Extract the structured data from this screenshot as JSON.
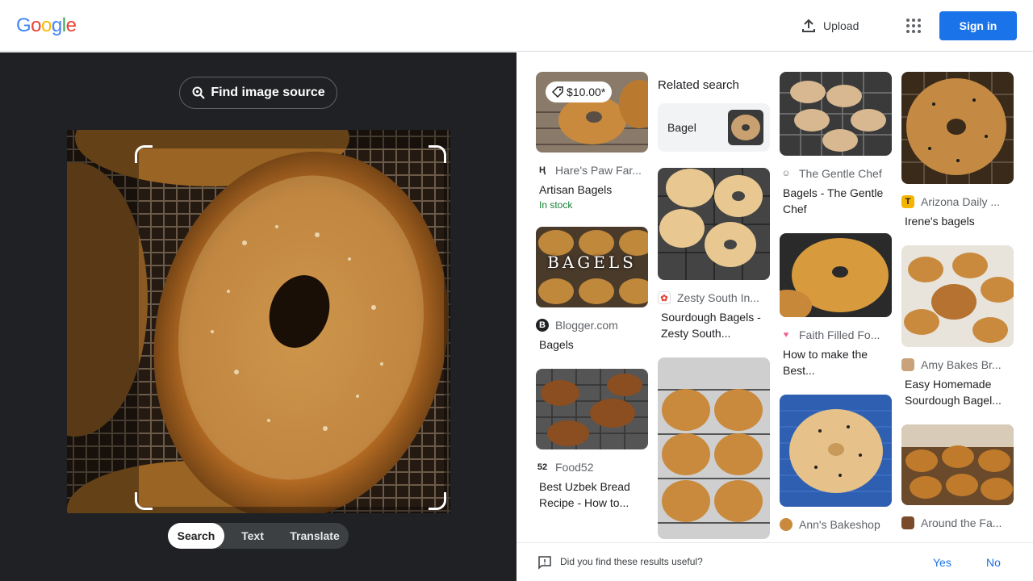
{
  "header": {
    "logo_letters": [
      "G",
      "o",
      "o",
      "g",
      "l",
      "e"
    ],
    "logo_colors": [
      "#4285f4",
      "#ea4335",
      "#fbbc05",
      "#4285f4",
      "#34a853",
      "#ea4335"
    ],
    "upload_label": "Upload",
    "signin_label": "Sign in"
  },
  "lens": {
    "find_source_label": "Find image source",
    "modes": [
      "Search",
      "Text",
      "Translate"
    ],
    "active_mode": "Search"
  },
  "related": {
    "heading": "Related search",
    "chip_label": "Bagel"
  },
  "results": [
    {
      "source": "Hare's Paw Far...",
      "title": "Artisan Bagels",
      "price": "$10.00*",
      "stock": "In stock"
    },
    {
      "source": "Blogger.com",
      "title": "Bagels",
      "overlay": "BAGELS"
    },
    {
      "source": "Food52",
      "title": "Best Uzbek Bread Recipe - How to..."
    },
    {
      "source": "Zesty South In...",
      "title": "Sourdough Bagels - Zesty South..."
    },
    {
      "source": "The Gentle Chef",
      "title": "Bagels - The Gentle Chef"
    },
    {
      "source": "Faith Filled Fo...",
      "title": "How to make the Best..."
    },
    {
      "source": "Ann's Bakeshop",
      "title": ""
    },
    {
      "source": "Arizona Daily ...",
      "title": "Irene's bagels"
    },
    {
      "source": "Amy Bakes Br...",
      "title": "Easy Homemade Sourdough Bagel..."
    },
    {
      "source": "Around the Fa...",
      "title": ""
    }
  ],
  "feedback": {
    "question": "Did you find these results useful?",
    "yes": "Yes",
    "no": "No"
  },
  "colors": {
    "accent": "#1a73e8",
    "dark_panel": "#202124",
    "stock_green": "#188038"
  }
}
